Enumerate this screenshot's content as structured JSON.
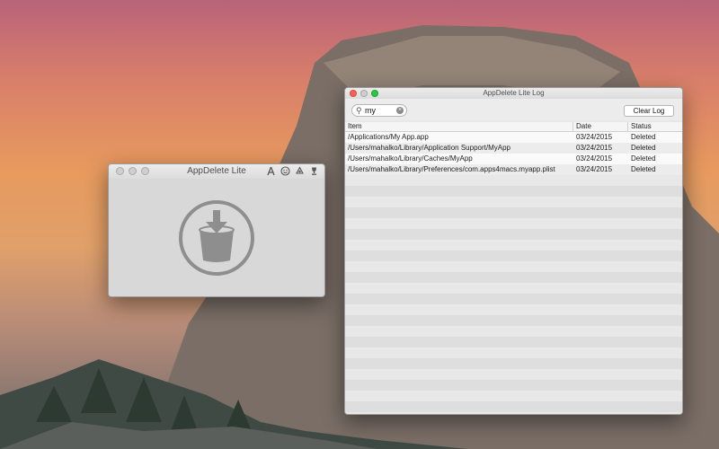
{
  "main_window": {
    "title": "AppDelete Lite",
    "toolbar_icons": [
      "app-store-icon",
      "smiley-icon",
      "recycle-icon",
      "trophy-icon"
    ],
    "drop_icon": "drop-bucket-icon"
  },
  "log_window": {
    "title": "AppDelete Lite Log",
    "search": {
      "value": "my",
      "icon": "search-icon"
    },
    "clear_button": "Clear Log",
    "columns": {
      "item": "Item",
      "date": "Date",
      "status": "Status"
    },
    "rows": [
      {
        "item": "/Applications/My App.app",
        "date": "03/24/2015",
        "status": "Deleted"
      },
      {
        "item": "/Users/mahalko/Library/Application Support/MyApp",
        "date": "03/24/2015",
        "status": "Deleted"
      },
      {
        "item": "/Users/mahalko/Library/Caches/MyApp",
        "date": "03/24/2015",
        "status": "Deleted"
      },
      {
        "item": "/Users/mahalko/Library/Preferences/com.apps4macs.myapp.plist",
        "date": "03/24/2015",
        "status": "Deleted"
      }
    ]
  },
  "colors": {
    "close": "#fc5f57",
    "minimize": "#fdbc2e",
    "zoom": "#28c840",
    "icon_gray": "#8e8e8e"
  }
}
